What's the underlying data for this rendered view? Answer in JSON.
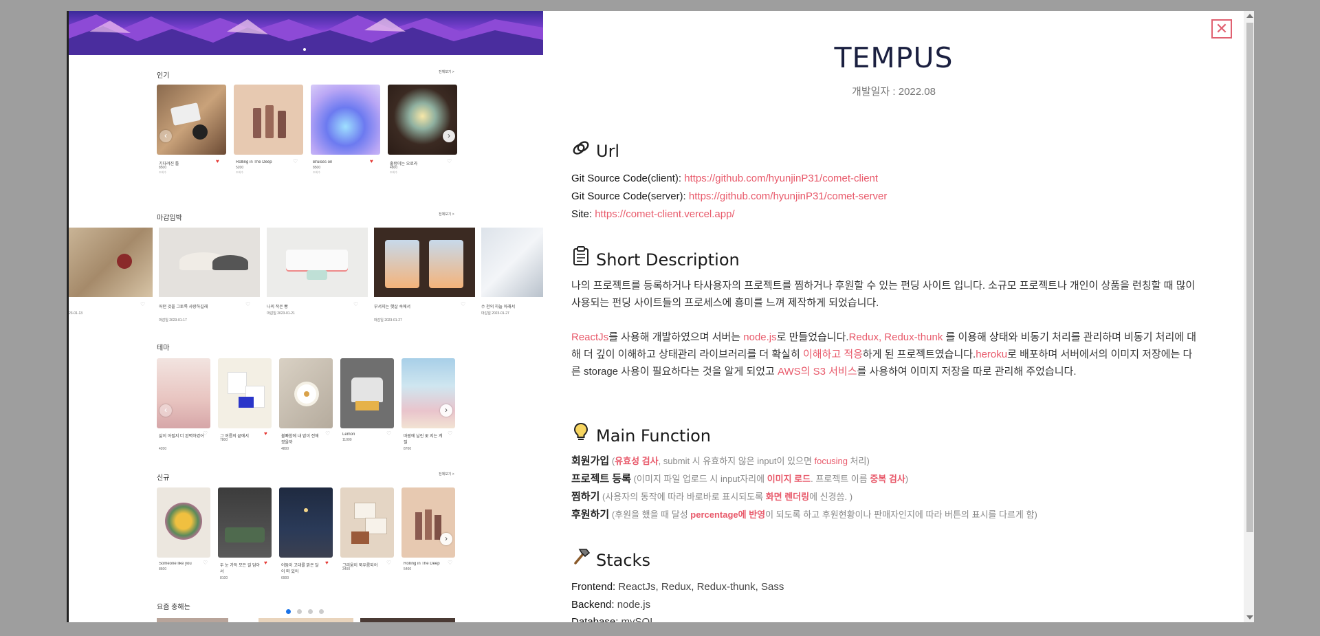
{
  "preview": {
    "popular": {
      "title": "인기",
      "more": "전체보기 >",
      "cards": [
        {
          "title": "기다려진 틀",
          "price": "8500",
          "sub": "조회수",
          "liked": true
        },
        {
          "title": "Rolling in The Deep",
          "price": "5200",
          "sub": "조회수",
          "liked": false
        },
        {
          "title": "Bruises on",
          "price": "8500",
          "sub": "조회수",
          "liked": true
        },
        {
          "title": "출렁이는 오로라",
          "price": "4800",
          "sub": "조회수",
          "liked": false
        }
      ]
    },
    "deadline": {
      "title": "마감임박",
      "more": "전체보기 >",
      "cards": [
        {
          "title": "",
          "date": "23-01-13"
        },
        {
          "title": "어떤 것을 그토록 사랑하길래",
          "date": "마감일 2023-01-17"
        },
        {
          "title": "나의 작은 빵",
          "date": "마감일 2023-01-21"
        },
        {
          "title": "부서지는 햇살 속에서",
          "date": "마감일 2023-01-27"
        },
        {
          "title": "수 천의 하늘 아래서",
          "date": "마감일 2023-01-27"
        }
      ]
    },
    "theme": {
      "title": "테마",
      "cards": [
        {
          "title": "삶이 아필지 더 완벽하였어",
          "price": "4200",
          "sub": "조회수",
          "liked": false
        },
        {
          "title": "그 여름의 끝에서",
          "price": "7800",
          "sub": "조회수",
          "liked": true
        },
        {
          "title": "불빠함에 내 맘이 전해졌을까",
          "price": "4800",
          "sub": "조회수",
          "liked": false
        },
        {
          "title": "Lemon",
          "price": "11000",
          "sub": "조회수",
          "liked": false
        },
        {
          "title": "바람에 날린 꽃 지는 계절",
          "price": "8700",
          "sub": "조회수",
          "liked": false
        }
      ]
    },
    "new": {
      "title": "신규",
      "more": "전체보기 >",
      "cards": [
        {
          "title": "Someone like you",
          "price": "8600",
          "sub": "조회수",
          "liked": false
        },
        {
          "title": "두 눈 가득 모든 걸 담아서",
          "price": "8100",
          "sub": "조회수",
          "liked": true
        },
        {
          "title": "어둠이 고대를 밝은 달이 떠 있어",
          "price": "6900",
          "sub": "조회수",
          "liked": true
        },
        {
          "title": "그리움이 묵우름되어",
          "price": "3400",
          "sub": "조회수",
          "liked": false
        },
        {
          "title": "Rolling in The Deep",
          "price": "5400",
          "sub": "조회수",
          "liked": false
        }
      ]
    },
    "recommend": {
      "title": "요즘 충해는"
    }
  },
  "detail": {
    "title": "TEMPUS",
    "date": "개발일자 : 2022.08",
    "url_section": {
      "heading": "Url",
      "client_label": "Git Source Code",
      "client_paren": "(client): ",
      "client_link": "https://github.com/hyunjinP31/comet-client",
      "server_label": "Git Source Code",
      "server_paren": "(server): ",
      "server_link": "https://github.com/hyunjinP31/comet-server",
      "site_label": "Site: ",
      "site_link": "https://comet-client.vercel.app/"
    },
    "short_desc": {
      "heading": "Short Description",
      "p1": "나의 프로젝트를 등록하거나 타사용자의 프로젝트를 찜하거나 후원할 수 있는 펀딩 사이트 입니다. 소규모 프로젝트나 개인이 상품을 런칭할 때 많이 사용되는 펀딩 사이트들의 프로세스에 흥미를 느껴 제작하게 되었습니다.",
      "p2": [
        {
          "t": "ReactJs",
          "pink": true
        },
        {
          "t": "를 사용해 개발하였으며 서버는 ",
          "pink": false
        },
        {
          "t": "node.js",
          "pink": true
        },
        {
          "t": "로 만들었습니다.",
          "pink": false
        },
        {
          "t": "Redux, Redux-thunk",
          "pink": true
        },
        {
          "t": " 를 이용해 상태와 비동기 처리를 관리하며 비동기 처리에 대해 더 깊이 이해하고 상태관리 라이브러리를 더 확실히 ",
          "pink": false
        },
        {
          "t": "이해하고 적응",
          "pink": true
        },
        {
          "t": "하게 된 프로젝트였습니다.",
          "pink": false
        },
        {
          "t": "heroku",
          "pink": true
        },
        {
          "t": "로 배포하며 서버에서의 이미지 저장에는 다른 storage 사용이 필요하다는 것을 알게 되었고 ",
          "pink": false
        },
        {
          "t": "AWS의 S3 서비스",
          "pink": true
        },
        {
          "t": "를 사용하여 이미지 저장을 따로 관리해 주었습니다.",
          "pink": false
        }
      ]
    },
    "main_function": {
      "heading": "Main Function",
      "items": [
        {
          "name": "회원가입",
          "parts": [
            {
              "t": " (",
              "c": "m"
            },
            {
              "t": "유효성 검사",
              "c": "h"
            },
            {
              "t": ", submit 시 유효하지 않은 input이 있으면 ",
              "c": "m"
            },
            {
              "t": "focusing",
              "c": "p"
            },
            {
              "t": " 처리)",
              "c": "m"
            }
          ]
        },
        {
          "name": "프로젝트 등록",
          "parts": [
            {
              "t": " (이미지 파일 업로드 시 input자리에 ",
              "c": "m"
            },
            {
              "t": "이미지 로드",
              "c": "h"
            },
            {
              "t": ". 프로젝트 이름 ",
              "c": "m"
            },
            {
              "t": "중복 검사",
              "c": "h"
            },
            {
              "t": ")",
              "c": "m"
            }
          ]
        },
        {
          "name": "찜하기",
          "parts": [
            {
              "t": " (사용자의 동작에 따라 바로바로 표시되도록 ",
              "c": "m"
            },
            {
              "t": "화면 렌더링",
              "c": "h"
            },
            {
              "t": "에 신경씀. )",
              "c": "m"
            }
          ]
        },
        {
          "name": "후원하기",
          "parts": [
            {
              "t": " (후원을 했을 때 달성 ",
              "c": "m"
            },
            {
              "t": "percentage에 반영",
              "c": "h"
            },
            {
              "t": "이 되도록 하고 후원현황이나 판매자인지에 따라 버튼의 표시를 다르게 함)",
              "c": "m"
            }
          ]
        }
      ]
    },
    "stacks": {
      "heading": "Stacks",
      "frontend_label": "Frontend: ",
      "frontend": "ReactJs, Redux, Redux-thunk, Sass",
      "backend_label": "Backend: ",
      "backend": "node.js",
      "database_label": "Database: ",
      "database": "mySQL"
    },
    "close_label": "✕"
  },
  "colors": {
    "accent": "#e8596a",
    "title": "#1b2040",
    "overlay": "#9e9e9e"
  },
  "icons": [
    "link-icon",
    "clipboard-icon",
    "lightbulb-icon",
    "hammer-icon",
    "close-icon",
    "chevron-right-icon",
    "heart-icon"
  ]
}
